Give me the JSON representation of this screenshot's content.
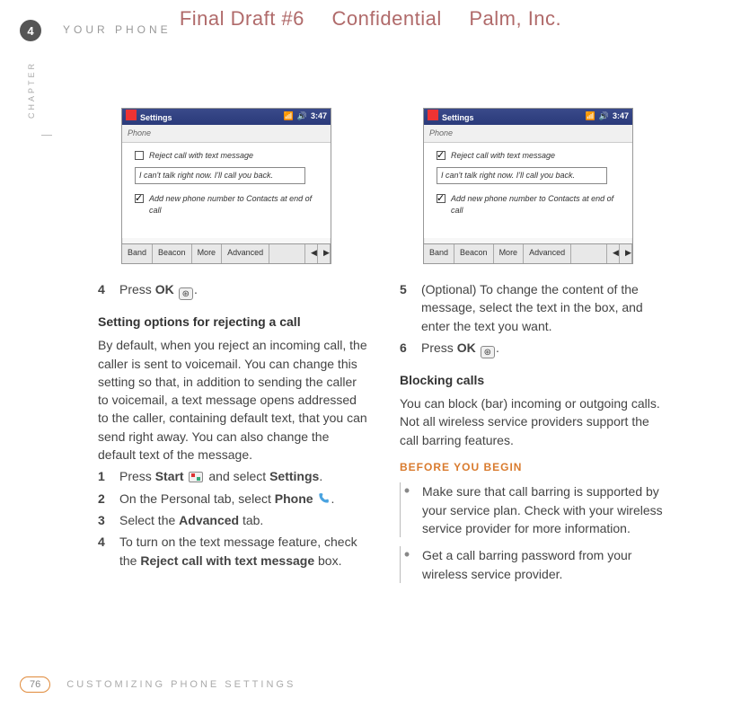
{
  "watermark": {
    "a": "Final Draft #6",
    "b": "Confidential",
    "c": "Palm, Inc."
  },
  "chapter_number": "4",
  "chapter_label": "CHAPTER",
  "section_header": "YOUR PHONE",
  "page_number": "76",
  "footer_text": "CUSTOMIZING PHONE SETTINGS",
  "screenshot": {
    "title": "Settings",
    "time": "3:47",
    "sub": "Phone",
    "reject_label": "Reject call with text message",
    "input_text": "I can't talk right now. I'll call you back.",
    "add_label": "Add new phone number to Contacts at end of call",
    "tabs": {
      "band": "Band",
      "beacon": "Beacon",
      "more": "More",
      "advanced": "Advanced"
    }
  },
  "left": {
    "step4": {
      "n": "4",
      "pre": "Press ",
      "bold": "OK",
      "post": " "
    },
    "subhead1": "Setting options for rejecting a call",
    "para1": "By default, when you reject an incoming call, the caller is sent to voicemail. You can change this setting so that, in addition to sending the caller to voicemail, a text message opens addressed to the caller, containing default text, that you can send right away. You can also change the default text of the message.",
    "s1": {
      "n": "1",
      "pre": "Press ",
      "b1": "Start",
      "mid": " and select ",
      "b2": "Settings",
      "post": "."
    },
    "s2": {
      "n": "2",
      "pre": "On the Personal tab, select ",
      "b1": "Phone",
      "post": " "
    },
    "s3": {
      "n": "3",
      "pre": "Select the ",
      "b1": "Advanced",
      "post": " tab."
    },
    "s4": {
      "n": "4",
      "pre": "To turn on the text message feature, check the ",
      "b1": "Reject call with text message",
      "post": " box."
    }
  },
  "right": {
    "s5": {
      "n": "5",
      "t": "(Optional) To change the content of the message, select the text in the box, and enter the text you want."
    },
    "s6": {
      "n": "6",
      "pre": "Press ",
      "b1": "OK",
      "post": " "
    },
    "subhead2": "Blocking calls",
    "para2": "You can block (bar) incoming or outgoing calls. Not all wireless service providers support the call barring features.",
    "before": "BEFORE YOU BEGIN",
    "bul1": "Make sure that call barring is supported by your service plan. Check with your wireless service provider for more information.",
    "bul2": "Get a call barring password from your wireless service provider."
  }
}
